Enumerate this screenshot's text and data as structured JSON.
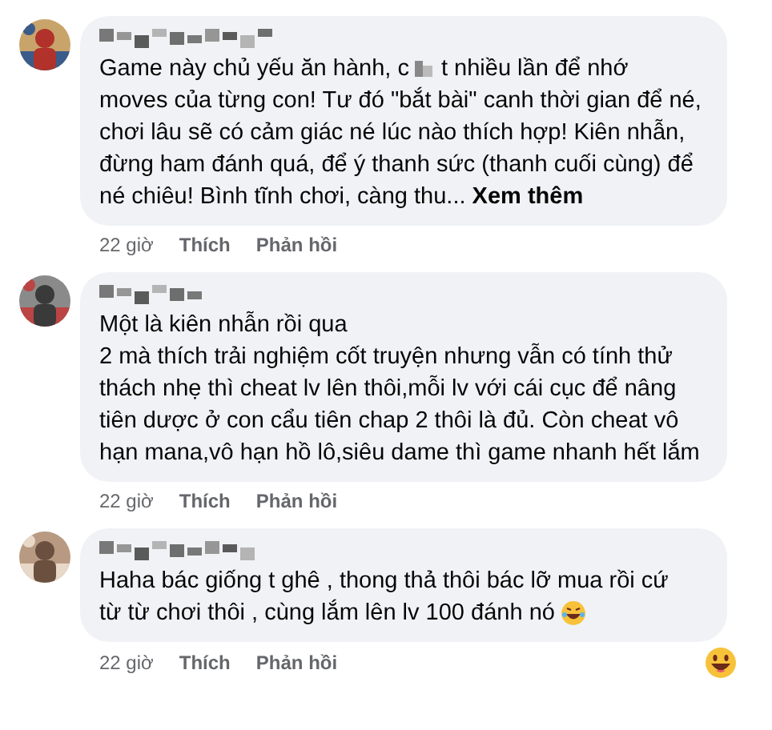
{
  "comments": [
    {
      "lines": [
        [
          {
            "kind": "text",
            "text": "Game này chủ yếu ăn hành, c"
          },
          {
            "kind": "redacted"
          },
          {
            "kind": "text",
            "text": "t nhiều lần để nhớ"
          }
        ],
        [
          {
            "kind": "text",
            "text": "moves của từng con! Tư đó \"bắt bài\" canh thời gian để né, chơi lâu sẽ có cảm giác né lúc nào thích hợp! Kiên nhẫn, đừng ham đánh quá, để ý thanh sức (thanh cuối cùng) để né chiêu! Bình tĩnh chơi, càng thu..."
          },
          {
            "kind": "more",
            "text": "Xem thêm"
          }
        ]
      ],
      "time": "22 giờ",
      "like": "Thích",
      "reply": "Phản hồi"
    },
    {
      "lines": [
        [
          {
            "kind": "text",
            "text": "Một là kiên nhẫn rồi qua\n2 mà thích trải nghiệm cốt truyện nhưng vẫn có tính thử thách nhẹ thì cheat lv lên thôi,mỗi lv với cái cục để nâng tiên dược ở con cẩu tiên chap 2 thôi là đủ. Còn cheat vô hạn mana,vô hạn hồ lô,siêu dame thì game nhanh hết lắm"
          }
        ]
      ],
      "time": "22 giờ",
      "like": "Thích",
      "reply": "Phản hồi"
    },
    {
      "lines": [
        [
          {
            "kind": "text",
            "text": "Haha bác giống t ghê , thong thả thôi bác lỡ mua rồi cứ"
          }
        ],
        [
          {
            "kind": "text",
            "text": "từ từ chơi thôi , cùng lắm lên lv 100 đánh nó"
          },
          {
            "kind": "emoji"
          }
        ]
      ],
      "time": "22 giờ",
      "like": "Thích",
      "reply": "Phản hồi"
    }
  ]
}
